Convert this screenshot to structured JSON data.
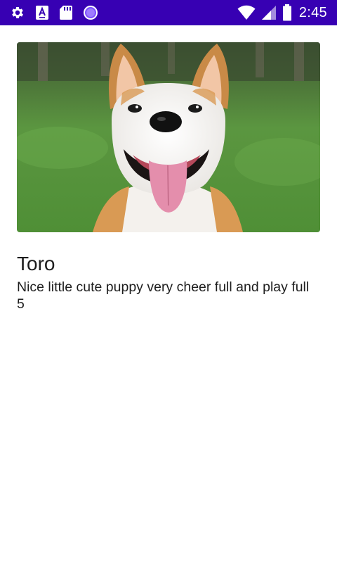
{
  "status_bar": {
    "time": "2:45",
    "icons": [
      "settings-icon",
      "text-app-icon",
      "sd-card-icon",
      "circle-app-icon",
      "wifi-icon",
      "cellular-signal-icon",
      "battery-icon"
    ],
    "background": "#3700b3"
  },
  "dog": {
    "name": "Toro",
    "description": "Nice little cute puppy very cheer full and play full",
    "age": "5"
  }
}
